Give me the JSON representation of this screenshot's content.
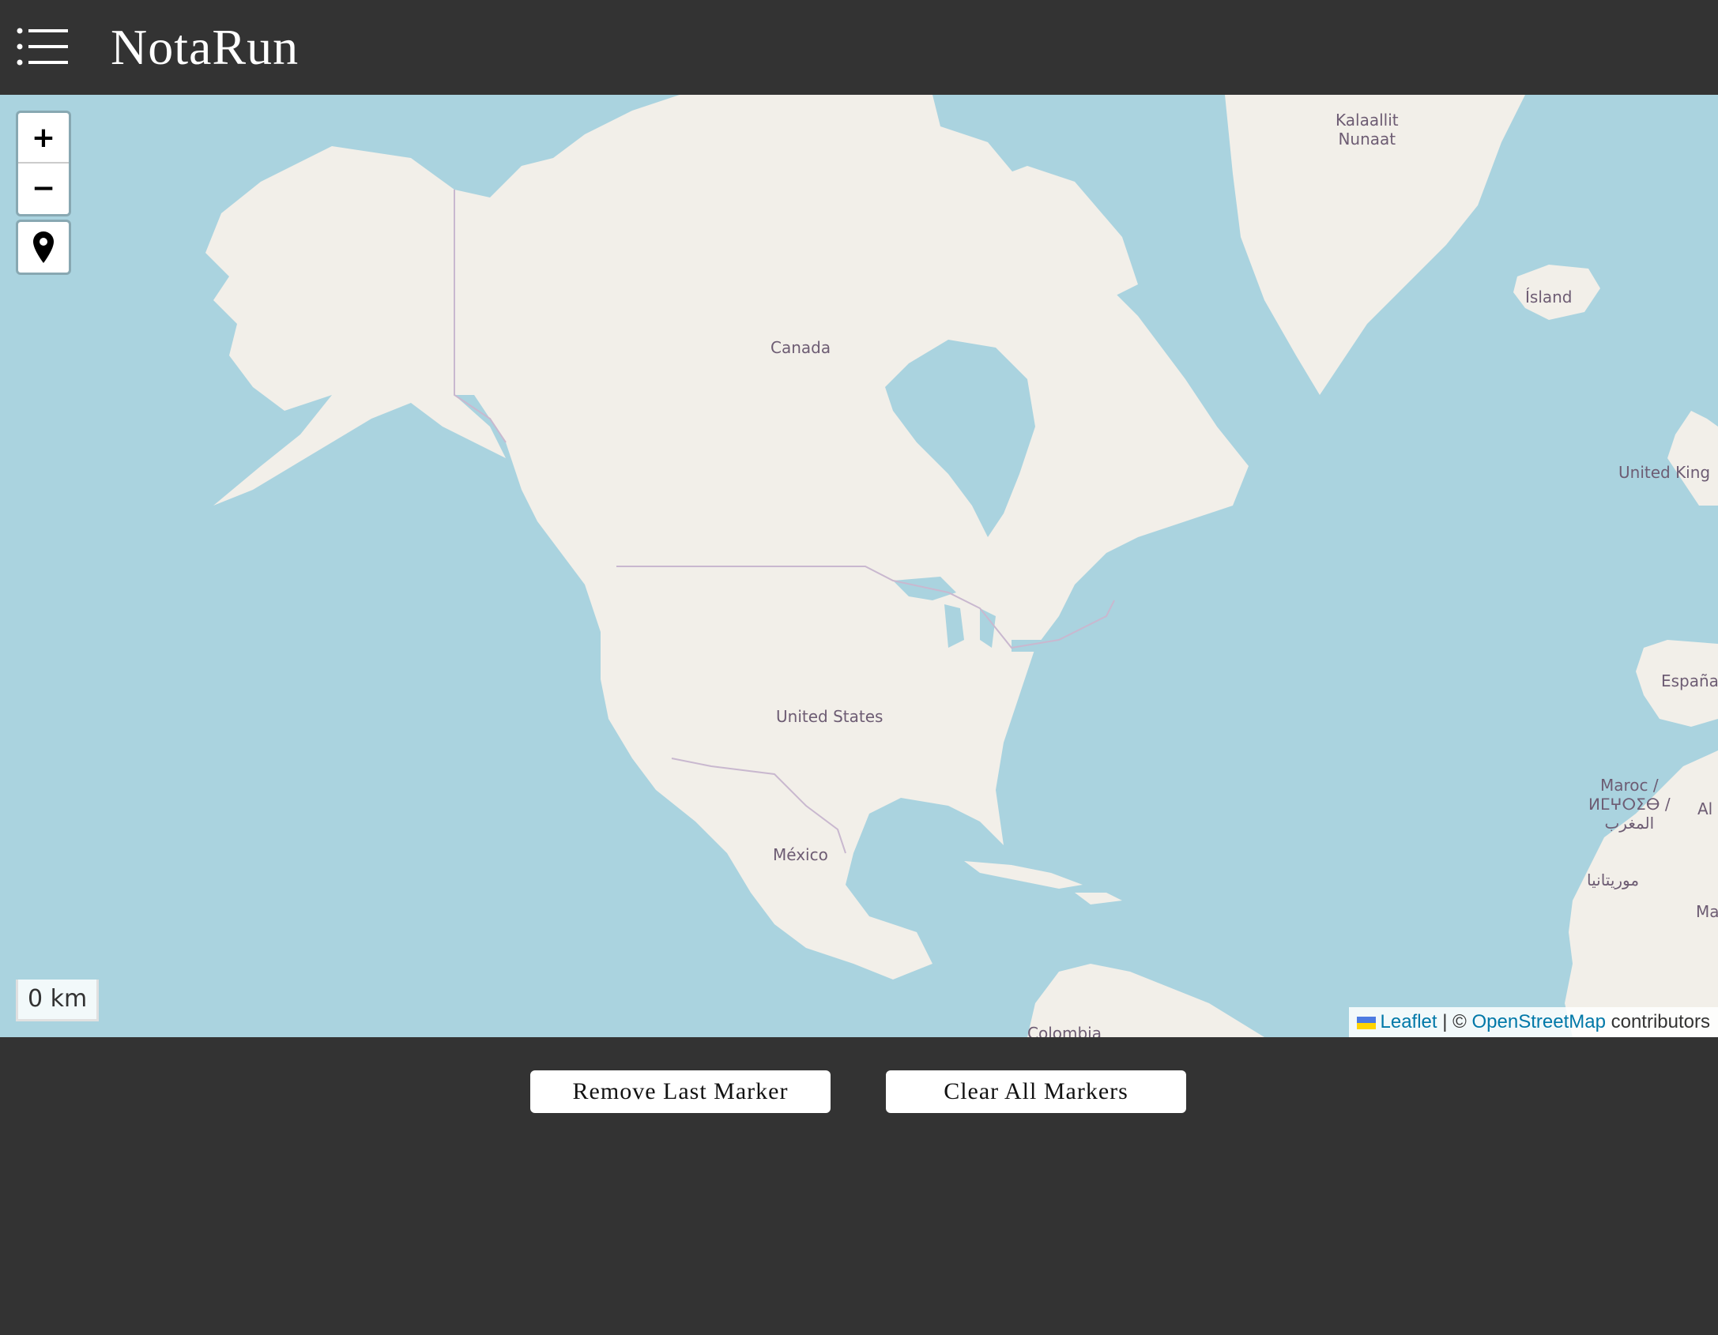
{
  "header": {
    "brand": "NotaRun",
    "menu_icon": "list-icon"
  },
  "map": {
    "zoom_in_label": "+",
    "zoom_out_label": "−",
    "locate_icon": "map-pin-icon",
    "scale_text": "0 km",
    "labels": {
      "kalaallit": "Kalaallit\nNunaat",
      "island": "Ísland",
      "canada": "Canada",
      "united_kingdom": "United King",
      "espana": "España",
      "united_states": "United States",
      "maroc": "Maroc /\nⵍⵎⵖⵔⵉⴱ /\nالمغرب",
      "al": "Al",
      "mexico": "México",
      "mauritania": "موريتانيا",
      "ma": "Ma",
      "colombia": "Colombia"
    },
    "attribution": {
      "leaflet": "Leaflet",
      "separator": " | © ",
      "osm": "OpenStreetMap",
      "suffix": " contributors"
    },
    "colors": {
      "water": "#aad3df",
      "land": "#f2efe9"
    }
  },
  "actions": {
    "remove_last": "Remove Last Marker",
    "clear_all": "Clear All Markers"
  }
}
